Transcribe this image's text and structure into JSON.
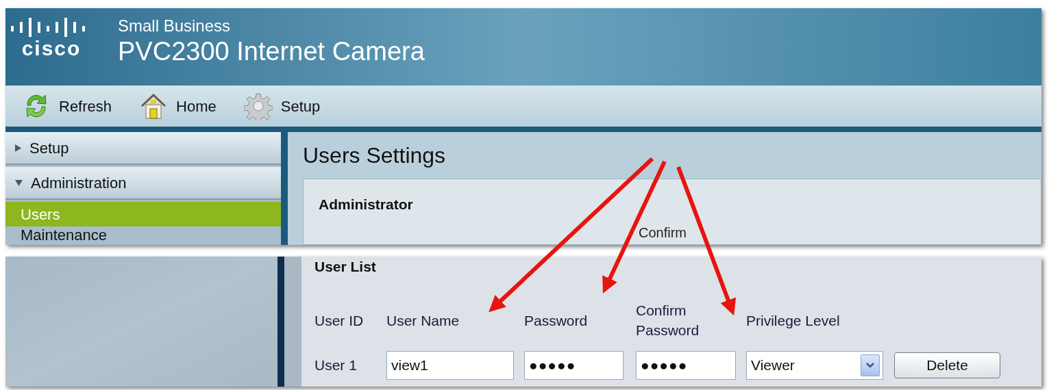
{
  "header": {
    "logo_text": "cisco",
    "subtitle": "Small Business",
    "title": "PVC2300 Internet Camera"
  },
  "toolbar": [
    {
      "kind": "refresh",
      "label": "Refresh"
    },
    {
      "kind": "home",
      "label": "Home"
    },
    {
      "kind": "gear",
      "label": "Setup"
    }
  ],
  "sidebar": [
    {
      "kind": "section",
      "label": "Setup",
      "expanded": false
    },
    {
      "kind": "section",
      "label": "Administration",
      "expanded": true
    },
    {
      "kind": "item",
      "label": "Users",
      "selected": true
    },
    {
      "kind": "item",
      "label": "Maintenance",
      "selected": false
    }
  ],
  "page_title": "Users Settings",
  "administrator": {
    "heading": "Administrator",
    "column_label": "Confirm"
  },
  "user_list": {
    "heading": "User List",
    "columns": [
      "User ID",
      "User Name",
      "Password",
      "Confirm Password",
      "Privilege Level"
    ],
    "rows": [
      {
        "user_id": "User 1",
        "user_name": "view1",
        "password": "●●●●●",
        "confirm_password": "●●●●●",
        "privilege": "Viewer",
        "button": "Delete"
      }
    ]
  }
}
